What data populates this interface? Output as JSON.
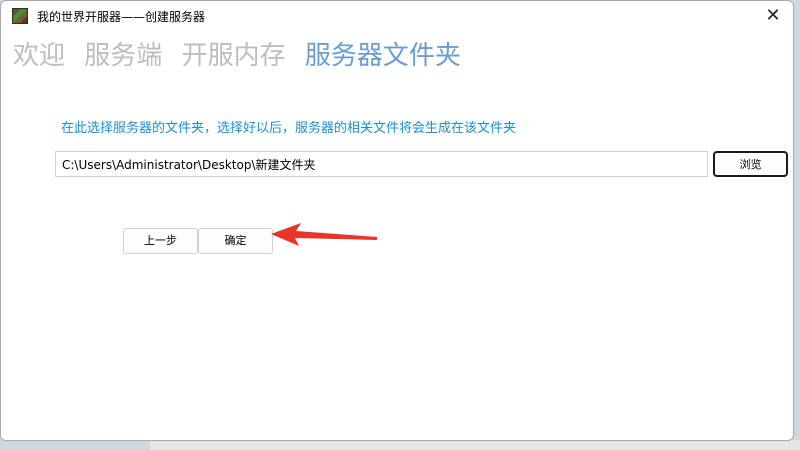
{
  "window": {
    "title": "我的世界开服器——创建服务器",
    "close_glyph": "✕"
  },
  "steps": [
    {
      "label": "欢迎",
      "active": false
    },
    {
      "label": "服务端",
      "active": false
    },
    {
      "label": "开服内存",
      "active": false
    },
    {
      "label": "服务器文件夹",
      "active": true
    }
  ],
  "instruction": "在此选择服务器的文件夹，选择好以后，服务器的相关文件将会生成在该文件夹",
  "folder": {
    "path_value": "C:\\Users\\Administrator\\Desktop\\新建文件夹",
    "browse_label": "浏览"
  },
  "nav": {
    "prev_label": "上一步",
    "ok_label": "确定"
  },
  "colors": {
    "active_step": "#6b9cd0",
    "inactive_step": "#bdbdbd",
    "instruction": "#1d8ed8",
    "annotation_arrow": "#e8342a"
  },
  "icons": {
    "app": "minecraft-block-icon",
    "close": "close-icon",
    "annotation": "red-arrow-annotation"
  }
}
